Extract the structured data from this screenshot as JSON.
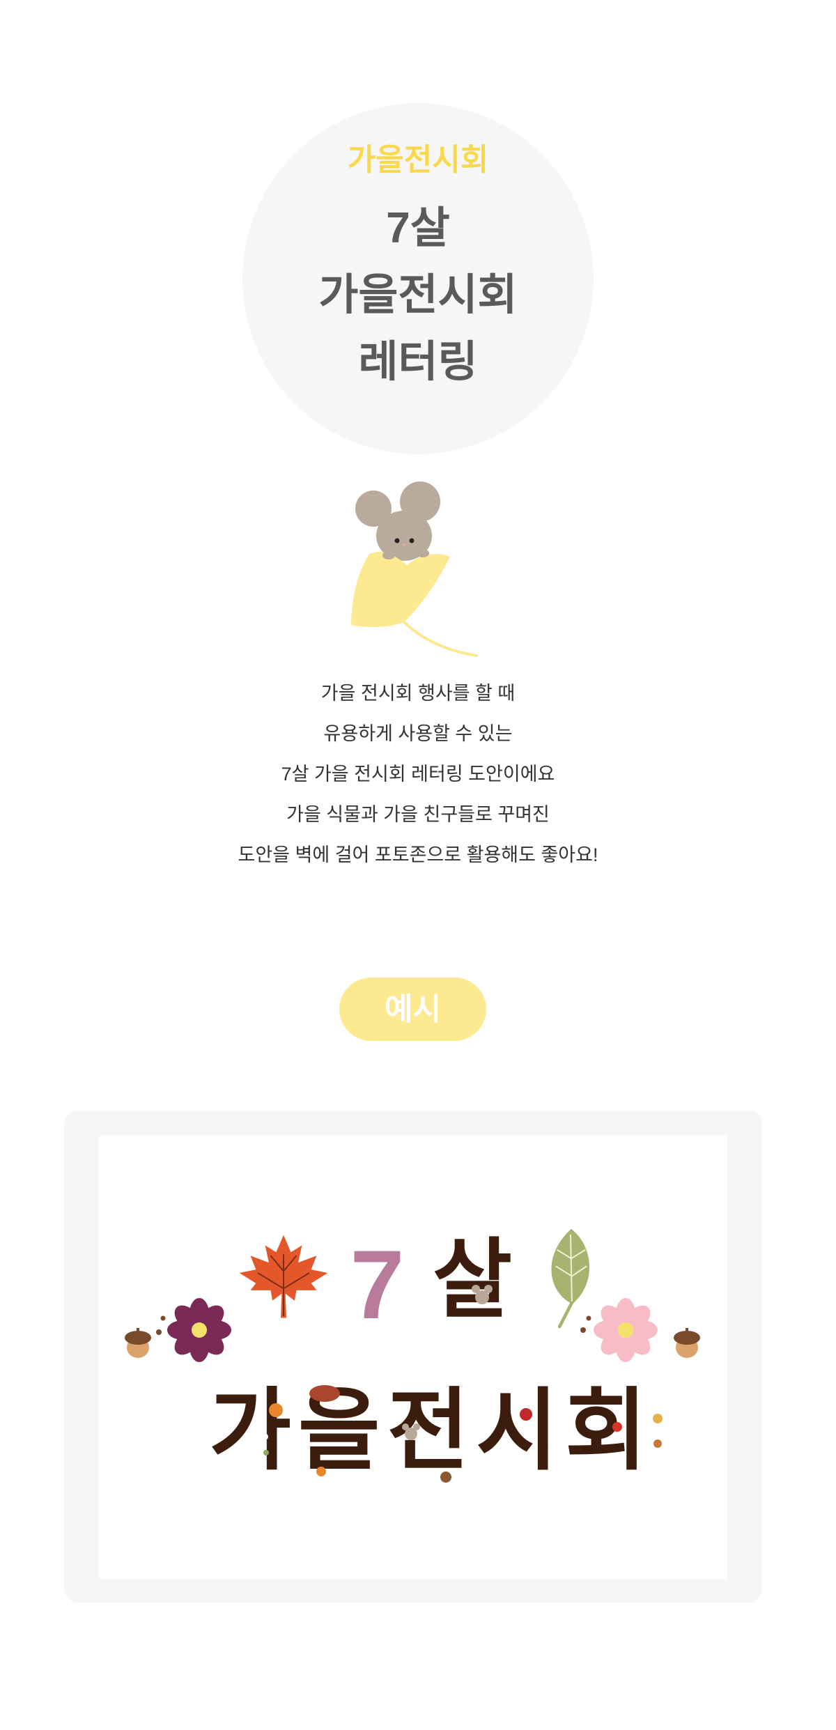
{
  "colors": {
    "accent_yellow": "#fad84c",
    "title_gray": "#5a5a5a",
    "body_text": "#333333",
    "badge_bg": "#fde98f",
    "badge_text": "#ffffff",
    "circle_bg": "#f6f6f6",
    "panel_bg": "#f6f6f6",
    "panel_inner": "#ffffff",
    "lettering_brown": "#3c1d0d",
    "lettering_mauve": "#b87b9b"
  },
  "hero": {
    "eyebrow": "가을전시회",
    "title_lines": [
      "7살",
      "가을전시회",
      "레터링"
    ],
    "illustration_icon": "mouse-ginkgo-icon"
  },
  "description": {
    "lines": [
      "가을 전시회 행사를 할 때",
      "유용하게 사용할 수 있는",
      "7살 가을 전시회 레터링 도안이에요",
      "가을 식물과 가을 친구들로 꾸며진",
      "도안을 벽에 걸어 포토존으로 활용해도 좋아요!"
    ]
  },
  "example": {
    "badge_label": "예시",
    "lettering": {
      "age_number": "7",
      "age_unit": "살",
      "event_name": "가을전시회"
    },
    "decor_icons": [
      "maple-leaf-icon",
      "green-leaf-icon",
      "purple-cosmos-icon",
      "pink-cosmos-icon",
      "acorn-icon"
    ]
  }
}
